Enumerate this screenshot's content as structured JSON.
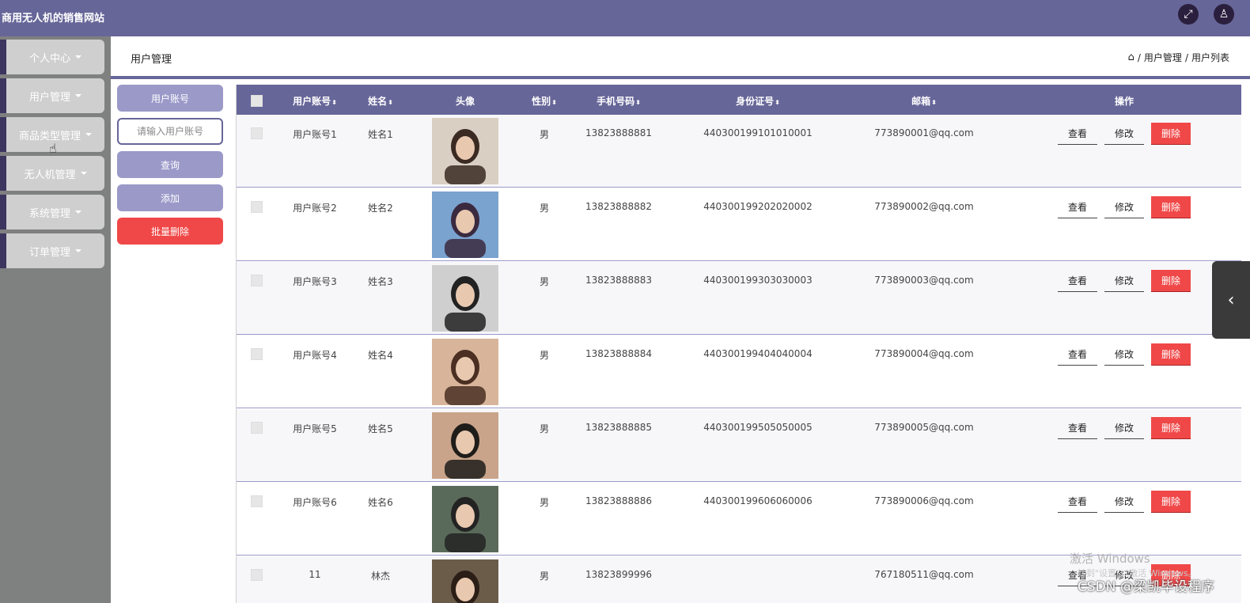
{
  "app": {
    "title": "商用无人机的销售网站"
  },
  "header_icons": [
    {
      "icon": "fullscreen-icon",
      "glyph": "⤢"
    },
    {
      "icon": "user-icon",
      "glyph": "♙"
    }
  ],
  "sidebar": {
    "items": [
      {
        "label": "个人中心"
      },
      {
        "label": "用户管理"
      },
      {
        "label": "商品类型管理"
      },
      {
        "label": "无人机管理"
      },
      {
        "label": "系统管理"
      },
      {
        "label": "订单管理"
      }
    ]
  },
  "page": {
    "title": "用户管理",
    "breadcrumb": {
      "home_glyph": "⌂",
      "part1": "用户管理",
      "sep": "/",
      "part2": "用户列表"
    }
  },
  "search": {
    "label_button": "用户账号",
    "placeholder": "请输入用户账号",
    "query_button": "查询",
    "add_button": "添加",
    "batch_delete_button": "批量删除"
  },
  "table": {
    "columns": [
      "用户账号",
      "姓名",
      "头像",
      "性别",
      "手机号码",
      "身份证号",
      "邮箱",
      "操作"
    ],
    "sort_glyph": "⬍",
    "actions": {
      "view": "查看",
      "edit": "修改",
      "delete": "删除"
    },
    "rows": [
      {
        "account": "用户账号1",
        "name": "姓名1",
        "gender": "男",
        "phone": "13823888881",
        "id_number": "440300199101010001",
        "email": "773890001@qq.com"
      },
      {
        "account": "用户账号2",
        "name": "姓名2",
        "gender": "男",
        "phone": "13823888882",
        "id_number": "440300199202020002",
        "email": "773890002@qq.com"
      },
      {
        "account": "用户账号3",
        "name": "姓名3",
        "gender": "男",
        "phone": "13823888883",
        "id_number": "440300199303030003",
        "email": "773890003@qq.com"
      },
      {
        "account": "用户账号4",
        "name": "姓名4",
        "gender": "男",
        "phone": "13823888884",
        "id_number": "440300199404040004",
        "email": "773890004@qq.com"
      },
      {
        "account": "用户账号5",
        "name": "姓名5",
        "gender": "男",
        "phone": "13823888885",
        "id_number": "440300199505050005",
        "email": "773890005@qq.com"
      },
      {
        "account": "用户账号6",
        "name": "姓名6",
        "gender": "男",
        "phone": "13823888886",
        "id_number": "440300199606060006",
        "email": "773890006@qq.com"
      },
      {
        "account": "11",
        "name": "林杰",
        "gender": "男",
        "phone": "13823899996",
        "id_number": "",
        "email": "767180511@qq.com"
      }
    ]
  },
  "side_tab": {
    "glyph": "‹"
  },
  "overlay": {
    "activation_title": "激活 Windows",
    "activation_sub": "转到\"设置\"以激活 Windows。",
    "csdn": "CSDN @梁凯毕设程序"
  },
  "colors": {
    "primary": "#676699",
    "danger": "#f04848",
    "sidebar_bg": "#7f8080",
    "menu_bg": "#cfcfcf"
  }
}
